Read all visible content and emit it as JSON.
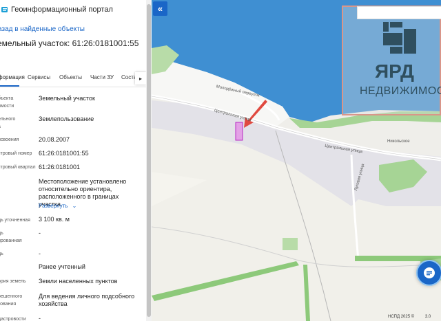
{
  "header": {
    "title": "Геоинформационный портал"
  },
  "panel": {
    "back_link": "азад в найденные объекты",
    "object_title": "емельный участок: 61:26:0181001:55",
    "tabs": [
      "формация",
      "Сервисы",
      "Объекты",
      "Части ЗУ",
      "Соста"
    ],
    "rows": [
      {
        "label1": "бъекта",
        "label2": "имости",
        "value": "Земельный участок"
      },
      {
        "label1": "ельного",
        "label2": "а",
        "value": "Землепользование"
      },
      {
        "label1": "исвоения",
        "value": "20.08.2007"
      },
      {
        "label1": "стровый номер",
        "value": "61:26:0181001:55"
      },
      {
        "label1": "стровый квартал",
        "value": "61:26:0181001"
      },
      {
        "value": "Местоположение установлено относительно ориентира, расположенного в границах участка."
      },
      {
        "label1": "дь уточненная",
        "value": "3 100 кв. м"
      },
      {
        "label1": "дь",
        "label2": "ированная",
        "value": "-"
      },
      {
        "label1": "дь",
        "value": "-"
      },
      {
        "value": "Ранее учтенный"
      },
      {
        "label1": "ория земель",
        "value": "Земли населенных пунктов"
      },
      {
        "label1": "решенного",
        "label2": "зования",
        "value": "Для ведения личного подсобного хозяйства"
      },
      {
        "label1": "дастровости",
        "value": "-"
      }
    ],
    "expand_label": "Развернуть"
  },
  "map": {
    "collapse_icon": "«",
    "labels": {
      "street1": "Молодёжный переулок",
      "street2": "Центральная улица",
      "street3": "Центральная улица",
      "street4": "Луговая улица",
      "village": "Никольское"
    },
    "watermark_brand": "ЯРД",
    "watermark_text": "НЕДВИЖИМОСТЬ",
    "footer": "НСПД 2025 ©",
    "footer_right": "3.0"
  },
  "colors": {
    "accent": "#1a66c7",
    "water": "#3f8fd2",
    "green": "#8dc97a"
  }
}
